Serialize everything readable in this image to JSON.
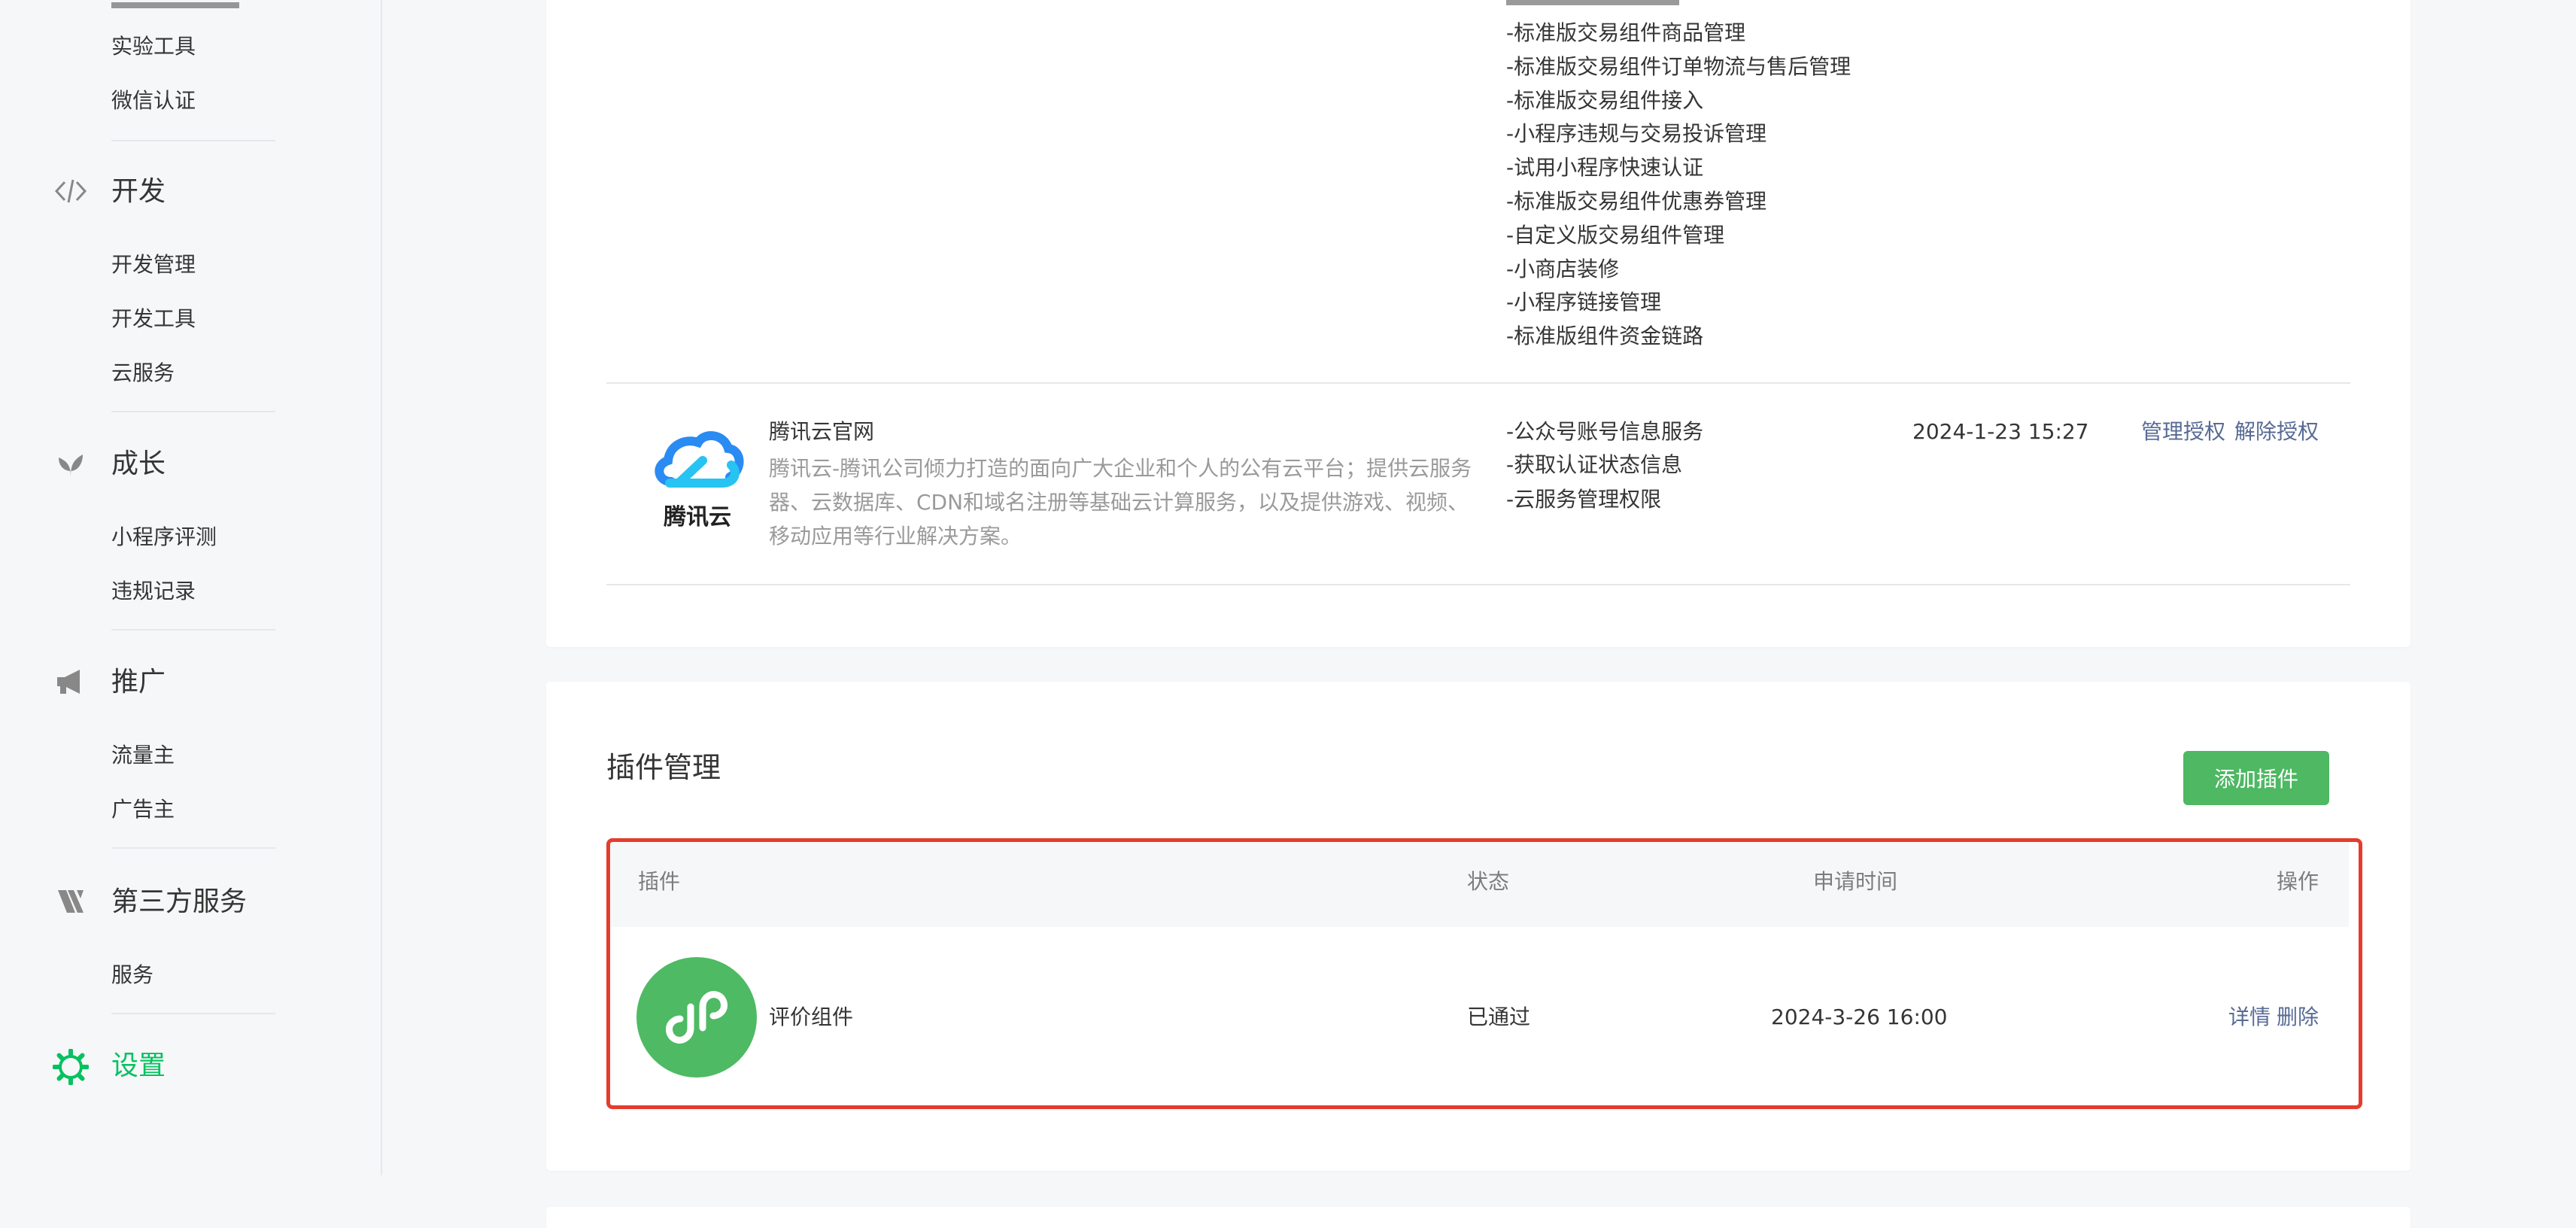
{
  "sidebar": {
    "groups": [
      {
        "items": [
          "实验工具",
          "微信认证"
        ]
      },
      {
        "title": "开发",
        "icon": "code-icon",
        "items": [
          "开发管理",
          "开发工具",
          "云服务"
        ]
      },
      {
        "title": "成长",
        "icon": "leaf-icon",
        "items": [
          "小程序评测",
          "违规记录"
        ]
      },
      {
        "title": "推广",
        "icon": "megaphone-icon",
        "items": [
          "流量主",
          "广告主"
        ]
      },
      {
        "title": "第三方服务",
        "icon": "third-party-icon",
        "items": [
          "服务"
        ]
      },
      {
        "title": "设置",
        "icon": "gear-icon",
        "active": true
      }
    ]
  },
  "authorized": {
    "permissions_top": [
      "-标准版交易组件商品管理",
      "-标准版交易组件订单物流与售后管理",
      "-标准版交易组件接入",
      "-小程序违规与交易投诉管理",
      "-试用小程序快速认证",
      "-标准版交易组件优惠券管理",
      "-自定义版交易组件管理",
      "-小商店装修",
      "-小程序链接管理",
      "-标准版组件资金链路"
    ],
    "tencent": {
      "logo_text": "腾讯云",
      "name": "腾讯云官网",
      "description": "腾讯云-腾讯公司倾力打造的面向广大企业和个人的公有云平台；提供云服务器、云数据库、CDN和域名注册等基础云计算服务，以及提供游戏、视频、移动应用等行业解决方案。",
      "permissions": [
        "-公众号账号信息服务",
        "-获取认证状态信息",
        "-云服务管理权限"
      ],
      "time": "2024-1-23 15:27",
      "manage_label": "管理授权",
      "revoke_label": "解除授权"
    }
  },
  "plugins": {
    "title": "插件管理",
    "add_label": "添加插件",
    "headers": {
      "plugin": "插件",
      "status": "状态",
      "time": "申请时间",
      "action": "操作"
    },
    "rows": [
      {
        "name": "评价组件",
        "status": "已通过",
        "time": "2024-3-26 16:00",
        "detail_label": "详情",
        "delete_label": "删除"
      }
    ]
  },
  "colors": {
    "accent": "#07c160",
    "link": "#576b95",
    "highlight": "#e53c2e",
    "button": "#4eb863"
  }
}
